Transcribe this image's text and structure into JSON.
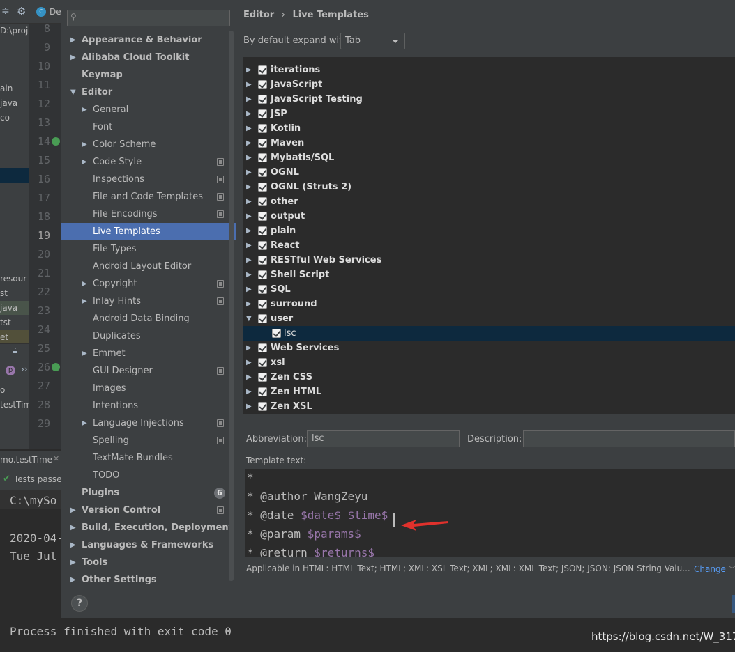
{
  "background": {
    "editor_tab_label": "De",
    "project_path": "D:\\proje",
    "project_rows": [
      "ain",
      "java",
      "co",
      "",
      "",
      "",
      "",
      "",
      "resour",
      "st",
      "java",
      "tst",
      "et"
    ],
    "line_numbers": [
      "8",
      "9",
      "10",
      "11",
      "12",
      "13",
      "14",
      "15",
      "16",
      "17",
      "18",
      "19",
      "20",
      "21",
      "22",
      "23",
      "24",
      "25",
      "26",
      "27",
      "28",
      "29"
    ],
    "side_text_1": "p",
    "side_text_2": "testTime(",
    "run_tab_label": "mo.testTime",
    "tests_status": "Tests passe",
    "console_lines": [
      "C:\\mySo",
      "",
      "2020-04-",
      "Tue Jul"
    ],
    "process_line": "Process finished with exit code 0"
  },
  "dialog": {
    "search_placeholder": "",
    "tree": [
      {
        "label": "Appearance & Behavior",
        "bold": true,
        "arrow": "right",
        "indent": 0
      },
      {
        "label": "Alibaba Cloud Toolkit",
        "bold": true,
        "arrow": "right",
        "indent": 0
      },
      {
        "label": "Keymap",
        "bold": true,
        "arrow": "",
        "indent": 0
      },
      {
        "label": "Editor",
        "bold": true,
        "arrow": "down",
        "indent": 0
      },
      {
        "label": "General",
        "bold": false,
        "arrow": "right",
        "indent": 1
      },
      {
        "label": "Font",
        "bold": false,
        "arrow": "",
        "indent": 1
      },
      {
        "label": "Color Scheme",
        "bold": false,
        "arrow": "right",
        "indent": 1
      },
      {
        "label": "Code Style",
        "bold": false,
        "arrow": "right",
        "indent": 1,
        "gear": true
      },
      {
        "label": "Inspections",
        "bold": false,
        "arrow": "",
        "indent": 1,
        "gear": true
      },
      {
        "label": "File and Code Templates",
        "bold": false,
        "arrow": "",
        "indent": 1,
        "gear": true
      },
      {
        "label": "File Encodings",
        "bold": false,
        "arrow": "",
        "indent": 1,
        "gear": true
      },
      {
        "label": "Live Templates",
        "bold": false,
        "arrow": "",
        "indent": 1,
        "selected": true
      },
      {
        "label": "File Types",
        "bold": false,
        "arrow": "",
        "indent": 1
      },
      {
        "label": "Android Layout Editor",
        "bold": false,
        "arrow": "",
        "indent": 1
      },
      {
        "label": "Copyright",
        "bold": false,
        "arrow": "right",
        "indent": 1,
        "gear": true
      },
      {
        "label": "Inlay Hints",
        "bold": false,
        "arrow": "right",
        "indent": 1,
        "gear": true
      },
      {
        "label": "Android Data Binding",
        "bold": false,
        "arrow": "",
        "indent": 1
      },
      {
        "label": "Duplicates",
        "bold": false,
        "arrow": "",
        "indent": 1
      },
      {
        "label": "Emmet",
        "bold": false,
        "arrow": "right",
        "indent": 1
      },
      {
        "label": "GUI Designer",
        "bold": false,
        "arrow": "",
        "indent": 1,
        "gear": true
      },
      {
        "label": "Images",
        "bold": false,
        "arrow": "",
        "indent": 1
      },
      {
        "label": "Intentions",
        "bold": false,
        "arrow": "",
        "indent": 1
      },
      {
        "label": "Language Injections",
        "bold": false,
        "arrow": "right",
        "indent": 1,
        "gear": true
      },
      {
        "label": "Spelling",
        "bold": false,
        "arrow": "",
        "indent": 1,
        "gear": true
      },
      {
        "label": "TextMate Bundles",
        "bold": false,
        "arrow": "",
        "indent": 1
      },
      {
        "label": "TODO",
        "bold": false,
        "arrow": "",
        "indent": 1
      },
      {
        "label": "Plugins",
        "bold": true,
        "arrow": "",
        "indent": 0,
        "badge": "6"
      },
      {
        "label": "Version Control",
        "bold": true,
        "arrow": "right",
        "indent": 0,
        "gear": true
      },
      {
        "label": "Build, Execution, Deployment",
        "bold": true,
        "arrow": "right",
        "indent": 0
      },
      {
        "label": "Languages & Frameworks",
        "bold": true,
        "arrow": "right",
        "indent": 0
      },
      {
        "label": "Tools",
        "bold": true,
        "arrow": "right",
        "indent": 0
      },
      {
        "label": "Other Settings",
        "bold": true,
        "arrow": "right",
        "indent": 0
      }
    ],
    "breadcrumb": {
      "parent": "Editor",
      "separator": "›",
      "current": "Live Templates"
    },
    "expand_label": "By default expand with",
    "expand_value": "Tab",
    "template_groups": [
      {
        "label": "iterations",
        "arrow": "right"
      },
      {
        "label": "JavaScript",
        "arrow": "right"
      },
      {
        "label": "JavaScript Testing",
        "arrow": "right"
      },
      {
        "label": "JSP",
        "arrow": "right"
      },
      {
        "label": "Kotlin",
        "arrow": "right"
      },
      {
        "label": "Maven",
        "arrow": "right"
      },
      {
        "label": "Mybatis/SQL",
        "arrow": "right"
      },
      {
        "label": "OGNL",
        "arrow": "right"
      },
      {
        "label": "OGNL (Struts 2)",
        "arrow": "right"
      },
      {
        "label": "other",
        "arrow": "right"
      },
      {
        "label": "output",
        "arrow": "right"
      },
      {
        "label": "plain",
        "arrow": "right"
      },
      {
        "label": "React",
        "arrow": "right"
      },
      {
        "label": "RESTful Web Services",
        "arrow": "right"
      },
      {
        "label": "Shell Script",
        "arrow": "right"
      },
      {
        "label": "SQL",
        "arrow": "right"
      },
      {
        "label": "surround",
        "arrow": "right"
      },
      {
        "label": "user",
        "arrow": "down"
      },
      {
        "label": "lsc",
        "arrow": "",
        "child": true,
        "selected": true
      },
      {
        "label": "Web Services",
        "arrow": "right"
      },
      {
        "label": "xsl",
        "arrow": "right"
      },
      {
        "label": "Zen CSS",
        "arrow": "right"
      },
      {
        "label": "Zen HTML",
        "arrow": "right"
      },
      {
        "label": "Zen XSL",
        "arrow": "right"
      }
    ],
    "abbreviation_label": "Abbreviation:",
    "abbreviation_value": "lsc",
    "description_label": "Description:",
    "description_value": "",
    "template_text_label": "Template text:",
    "template_lines": [
      {
        "plain": "*",
        "var": ""
      },
      {
        "plain": "* @author WangZeyu",
        "var": ""
      },
      {
        "plain": "* @date ",
        "var": "$date$ $time$"
      },
      {
        "plain": "* @param ",
        "var": "$params$"
      },
      {
        "plain": "* @return ",
        "var": "$returns$"
      }
    ],
    "applicable_text": "Applicable in HTML: HTML Text; HTML; XML: XSL Text; XML; XML: XML Text; JSON; JSON: JSON String Valu...",
    "change_label": "Change",
    "help_label": "?"
  },
  "watermark": "https://blog.csdn.net/W_317",
  "colors": {
    "accent": "#4b6eaf",
    "variable": "#9876aa",
    "link": "#589df6",
    "arrow": "#e0312c"
  }
}
